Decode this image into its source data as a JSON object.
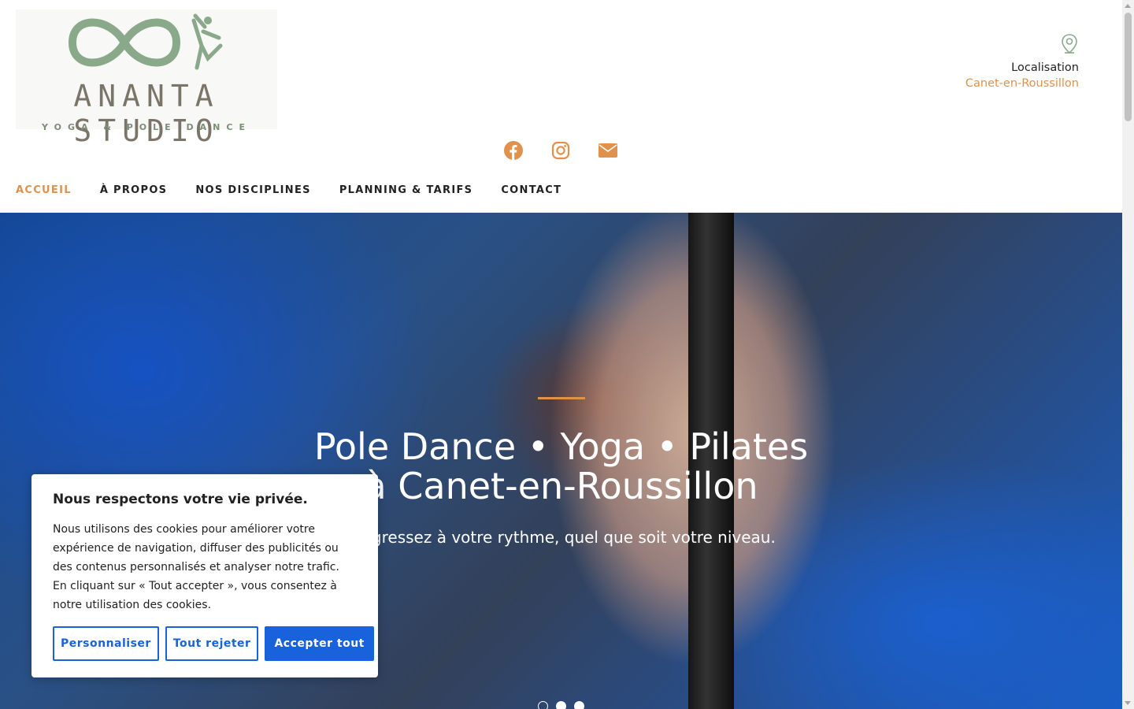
{
  "brand": {
    "title": "ANANTA STUDIO",
    "subtitle": "YOGA & POLE DANCE",
    "logo_color": "#8aa88a"
  },
  "location": {
    "icon": "map-pin-icon",
    "label": "Localisation",
    "value": "Canet-en-Roussillon"
  },
  "social": [
    {
      "name": "facebook-icon"
    },
    {
      "name": "instagram-icon"
    },
    {
      "name": "email-icon"
    }
  ],
  "nav": {
    "items": [
      {
        "label": "ACCUEIL",
        "active": true
      },
      {
        "label": "À PROPOS",
        "active": false
      },
      {
        "label": "NOS DISCIPLINES",
        "active": false
      },
      {
        "label": "PLANNING & TARIFS",
        "active": false
      },
      {
        "label": "CONTACT",
        "active": false
      }
    ]
  },
  "hero": {
    "title_line1": "Pole Dance • Yoga • Pilates",
    "title_line2": "à Canet-en-Roussillon",
    "subtitle": "Progressez à votre rythme, quel que soit votre niveau.",
    "slide_count": 3,
    "active_slide": 1
  },
  "cookie": {
    "heading": "Nous respectons votre vie privée.",
    "body": "Nous utilisons des cookies pour améliorer votre expérience de navigation, diffuser des publicités ou des contenus personnalisés et analyser notre trafic. En cliquant sur « Tout accepter », vous consentez à notre utilisation des cookies.",
    "customize": "Personnaliser",
    "reject": "Tout rejeter",
    "accept": "Accepter tout"
  },
  "colors": {
    "accent": "#e0914c",
    "cookie_blue": "#1863dc"
  }
}
